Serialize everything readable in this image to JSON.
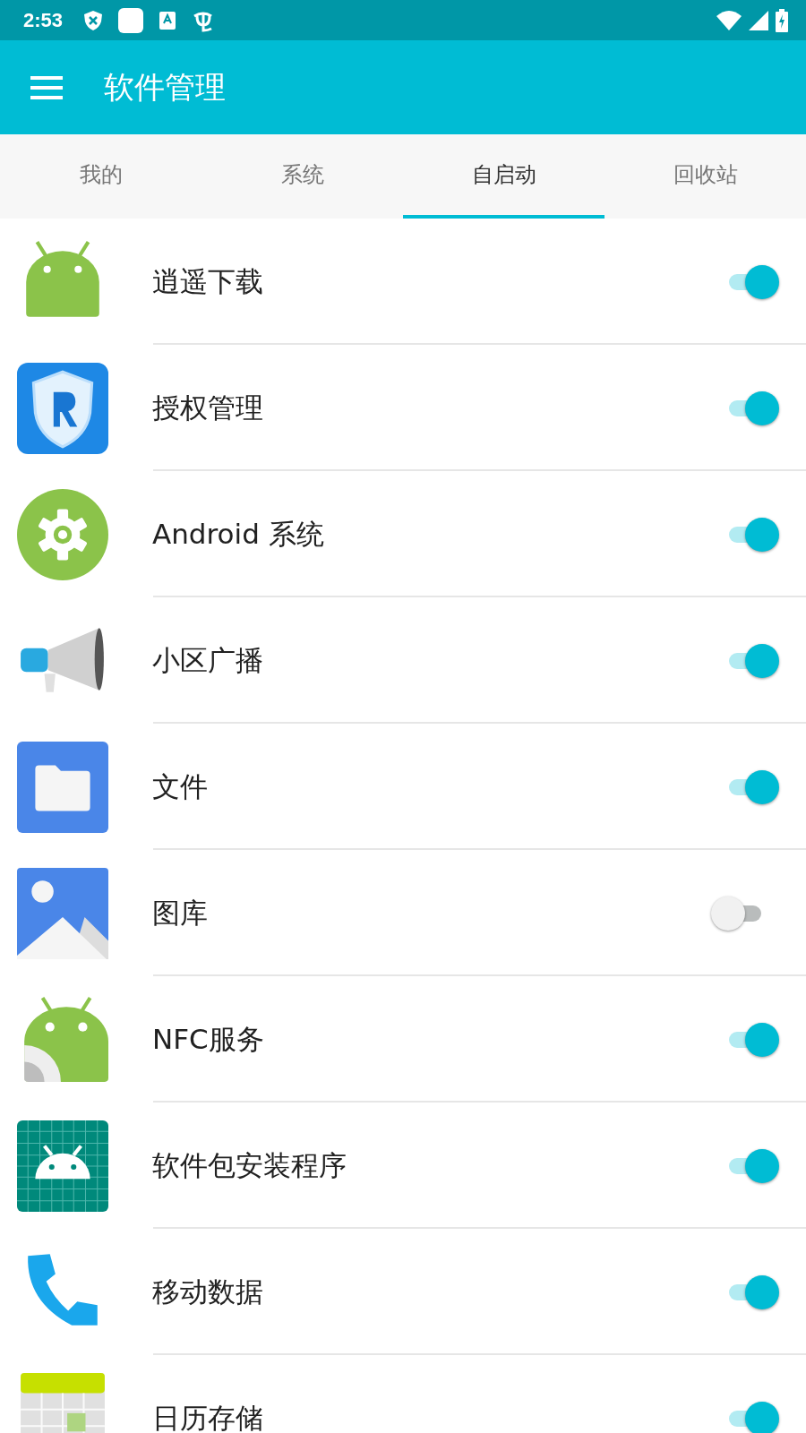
{
  "status_bar": {
    "time": "2:53"
  },
  "app_bar": {
    "title": "软件管理"
  },
  "tabs": [
    {
      "label": "我的",
      "selected": false
    },
    {
      "label": "系统",
      "selected": false
    },
    {
      "label": "自启动",
      "selected": true
    },
    {
      "label": "回收站",
      "selected": false
    }
  ],
  "apps": [
    {
      "name": "逍遥下载",
      "on": true
    },
    {
      "name": "授权管理",
      "on": true
    },
    {
      "name": "Android 系统",
      "on": true
    },
    {
      "name": "小区广播",
      "on": true
    },
    {
      "name": "文件",
      "on": true
    },
    {
      "name": "图库",
      "on": false
    },
    {
      "name": "NFC服务",
      "on": true
    },
    {
      "name": "软件包安装程序",
      "on": true
    },
    {
      "name": "移动数据",
      "on": true
    },
    {
      "name": "日历存储",
      "on": true
    }
  ]
}
